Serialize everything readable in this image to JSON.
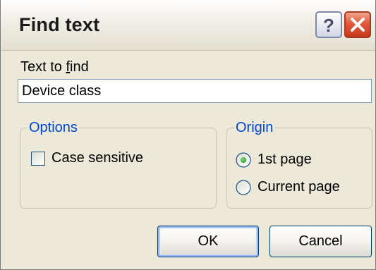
{
  "window": {
    "title": "Find text",
    "help_icon": "help-icon",
    "close_icon": "close-icon"
  },
  "find": {
    "label_prefix": "Text to ",
    "label_accel": "f",
    "label_suffix": "ind",
    "value": "Device class"
  },
  "options": {
    "legend": "Options",
    "case_sensitive": {
      "label": "Case sensitive",
      "checked": false
    }
  },
  "origin": {
    "legend": "Origin",
    "first_page": {
      "label": "1st page",
      "selected": true
    },
    "current_page": {
      "label": "Current page",
      "selected": false
    }
  },
  "buttons": {
    "ok": "OK",
    "cancel": "Cancel"
  },
  "colors": {
    "dialog_bg": "#ece9d8",
    "legend_text": "#0046d5",
    "close_red": "#e2593a",
    "radio_dot": "#21a121"
  }
}
